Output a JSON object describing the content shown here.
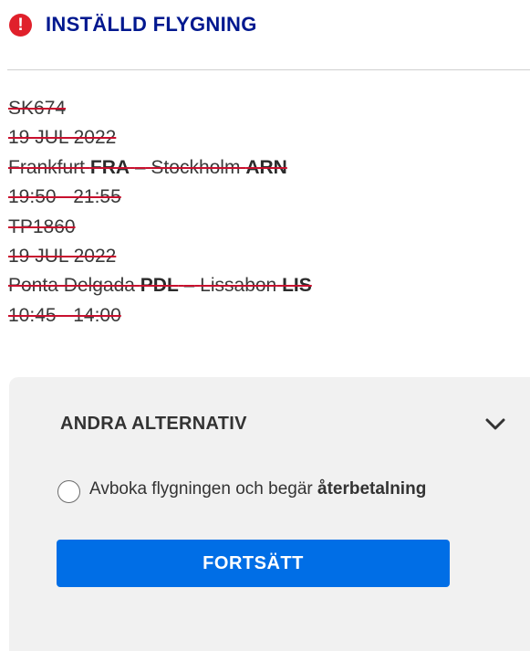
{
  "header": {
    "title": "INSTÄLLD FLYGNING",
    "alert_icon": "exclamation-icon",
    "alert_color": "#e0202b",
    "title_color": "#00188f"
  },
  "flights": [
    {
      "number": "SK674",
      "date": "19 JUL 2022",
      "origin_city": "Frankfurt",
      "origin_code": "FRA",
      "separator": "–",
      "dest_city": "Stockholm",
      "dest_code": "ARN",
      "time": "19:50 - 21:55"
    },
    {
      "number": "TP1860",
      "date": "19 JUL 2022",
      "origin_city": "Ponta Delgada",
      "origin_code": "PDL",
      "separator": "–",
      "dest_city": "Lissabon",
      "dest_code": "LIS",
      "time": "10:45 - 14:00"
    }
  ],
  "options": {
    "title": "ANDRA ALTERNATIV",
    "toggle_icon": "chevron-down-icon",
    "radio_label_prefix": "Avboka flygningen och begär",
    "radio_label_bold": "återbetalning",
    "radio_selected": false
  },
  "continue_label": "FORTSÄTT",
  "colors": {
    "strike": "#c8102e",
    "button": "#006ee6",
    "panel": "#f1f1f1"
  }
}
